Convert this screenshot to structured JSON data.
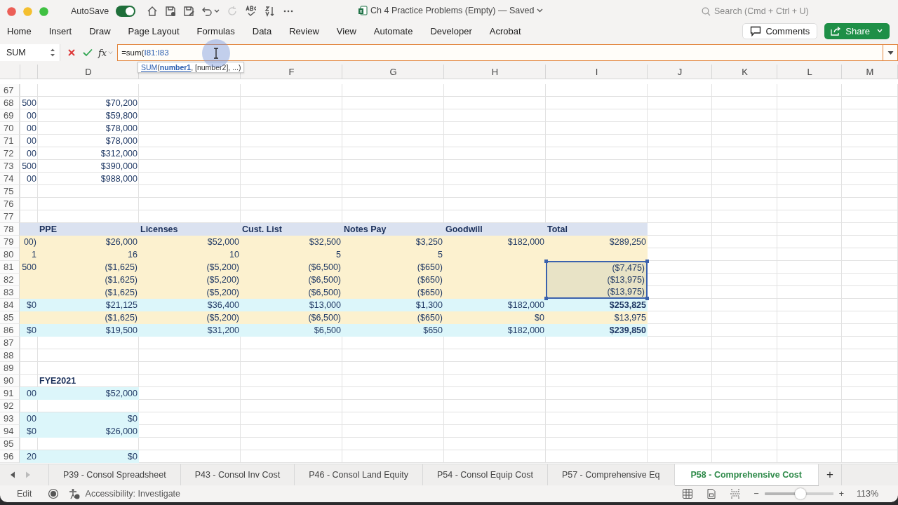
{
  "titlebar": {
    "autosave_label": "AutoSave",
    "autosave_on": true,
    "title": "Ch 4 Practice Problems (Empty) — Saved",
    "search_placeholder": "Search (Cmd + Ctrl + U)"
  },
  "ribbon_tabs": [
    "Home",
    "Insert",
    "Draw",
    "Page Layout",
    "Formulas",
    "Data",
    "Review",
    "View",
    "Automate",
    "Developer",
    "Acrobat"
  ],
  "comments_button": "Comments",
  "share_button": "Share",
  "formula_bar": {
    "name_box": "SUM",
    "function_button": "fx",
    "formula_prefix": "=sum(",
    "formula_reference": "I81:I83",
    "tooltip_function": "SUM",
    "tooltip_arguments": "(**number1**, [number2], ...)"
  },
  "column_headers": [
    "D",
    "F",
    "G",
    "H",
    "I",
    "J",
    "K",
    "L",
    "M"
  ],
  "rows": [
    {
      "number": "67",
      "kind": "plain",
      "selected": false,
      "cells": {}
    },
    {
      "number": "68",
      "kind": "plain",
      "selected": false,
      "cells": {
        "c": "500",
        "d": "$70,200"
      }
    },
    {
      "number": "69",
      "kind": "plain",
      "selected": false,
      "cells": {
        "c": "00",
        "d": "$59,800"
      }
    },
    {
      "number": "70",
      "kind": "plain",
      "selected": false,
      "cells": {
        "c": "00",
        "d": "$78,000"
      }
    },
    {
      "number": "71",
      "kind": "plain",
      "selected": false,
      "cells": {
        "c": "00",
        "d": "$78,000"
      }
    },
    {
      "number": "72",
      "kind": "plain",
      "selected": false,
      "cells": {
        "c": "00",
        "d": "$312,000"
      }
    },
    {
      "number": "73",
      "kind": "plain",
      "selected": false,
      "cells": {
        "c": "500",
        "d": "$390,000"
      }
    },
    {
      "number": "74",
      "kind": "plain",
      "selected": false,
      "cells": {
        "c": "00",
        "d": "$988,000"
      }
    },
    {
      "number": "75",
      "kind": "plain",
      "selected": false,
      "cells": {}
    },
    {
      "number": "76",
      "kind": "plain",
      "selected": false,
      "cells": {}
    },
    {
      "number": "77",
      "kind": "plain",
      "selected": false,
      "cells": {}
    },
    {
      "number": "78",
      "kind": "band-header",
      "selected": false,
      "cells": {
        "d": "PPE",
        "e": "Licenses",
        "f": "Cust. List",
        "g": "Notes Pay",
        "h": "Goodwill",
        "i": "Total"
      }
    },
    {
      "number": "79",
      "kind": "tan",
      "selected": false,
      "cells": {
        "c": "00)",
        "d": "$26,000",
        "e": "$52,000",
        "f": "$32,500",
        "g": "$3,250",
        "h": "$182,000",
        "i": "$289,250"
      }
    },
    {
      "number": "80",
      "kind": "tan",
      "selected": false,
      "cells": {
        "c": "1",
        "d": "16",
        "e": "10",
        "f": "5",
        "g": "5"
      }
    },
    {
      "number": "81",
      "kind": "tan",
      "selected": true,
      "cells": {
        "c": "500",
        "d": "($1,625)",
        "e": "($5,200)",
        "f": "($6,500)",
        "g": "($650)",
        "i": "($7,475)"
      }
    },
    {
      "number": "82",
      "kind": "tan",
      "selected": true,
      "cells": {
        "d": "($1,625)",
        "e": "($5,200)",
        "f": "($6,500)",
        "g": "($650)",
        "i": "($13,975)"
      }
    },
    {
      "number": "83",
      "kind": "tan",
      "selected": true,
      "cells": {
        "d": "($1,625)",
        "e": "($5,200)",
        "f": "($6,500)",
        "g": "($650)",
        "i": "($13,975)"
      }
    },
    {
      "number": "84",
      "kind": "total",
      "selected": false,
      "cells": {
        "c": "$0",
        "d": "$21,125",
        "e": "$36,400",
        "f": "$13,000",
        "g": "$1,300",
        "h": "$182,000",
        "i": "$253,825"
      }
    },
    {
      "number": "85",
      "kind": "tan",
      "selected": false,
      "cells": {
        "d": "($1,625)",
        "e": "($5,200)",
        "f": "($6,500)",
        "g": "($650)",
        "h": "$0",
        "i": "$13,975"
      }
    },
    {
      "number": "86",
      "kind": "total",
      "selected": false,
      "cells": {
        "c": "$0",
        "d": "$19,500",
        "e": "$31,200",
        "f": "$6,500",
        "g": "$650",
        "h": "$182,000",
        "i": "$239,850"
      }
    },
    {
      "number": "87",
      "kind": "plain",
      "selected": false,
      "cells": {}
    },
    {
      "number": "88",
      "kind": "plain",
      "selected": false,
      "cells": {}
    },
    {
      "number": "89",
      "kind": "plain",
      "selected": false,
      "cells": {}
    },
    {
      "number": "90",
      "kind": "section-header",
      "selected": false,
      "cells": {
        "d": "FYE2021"
      }
    },
    {
      "number": "91",
      "kind": "fye",
      "selected": false,
      "cells": {
        "c": "00",
        "d": "$52,000"
      }
    },
    {
      "number": "92",
      "kind": "plain",
      "selected": false,
      "cells": {}
    },
    {
      "number": "93",
      "kind": "fye",
      "selected": false,
      "cells": {
        "c": "00",
        "d": "$0"
      }
    },
    {
      "number": "94",
      "kind": "fye",
      "selected": false,
      "cells": {
        "c": "$0",
        "d": "$26,000"
      }
    },
    {
      "number": "95",
      "kind": "plain",
      "selected": false,
      "cells": {}
    },
    {
      "number": "96",
      "kind": "fye",
      "selected": false,
      "cells": {
        "c": "20",
        "d": "$0"
      }
    }
  ],
  "sheet_tabs": [
    {
      "label": "P39 - Consol Spreadsheet",
      "selected": false
    },
    {
      "label": "P43 - Consol Inv Cost",
      "selected": false
    },
    {
      "label": "P46 - Consol Land Equity",
      "selected": false
    },
    {
      "label": "P54 - Consol Equip Cost",
      "selected": false
    },
    {
      "label": "P57 - Comprehensive Eq",
      "selected": false
    },
    {
      "label": "P58 - Comprehensive Cost",
      "selected": true
    }
  ],
  "add_sheet": "+",
  "status_bar": {
    "mode": "Edit",
    "accessibility": "Accessibility: Investigate",
    "zoom": {
      "level": 0.52
    },
    "zoom_minus": "−",
    "zoom_plus": "+",
    "zoom_percent": "113%"
  }
}
